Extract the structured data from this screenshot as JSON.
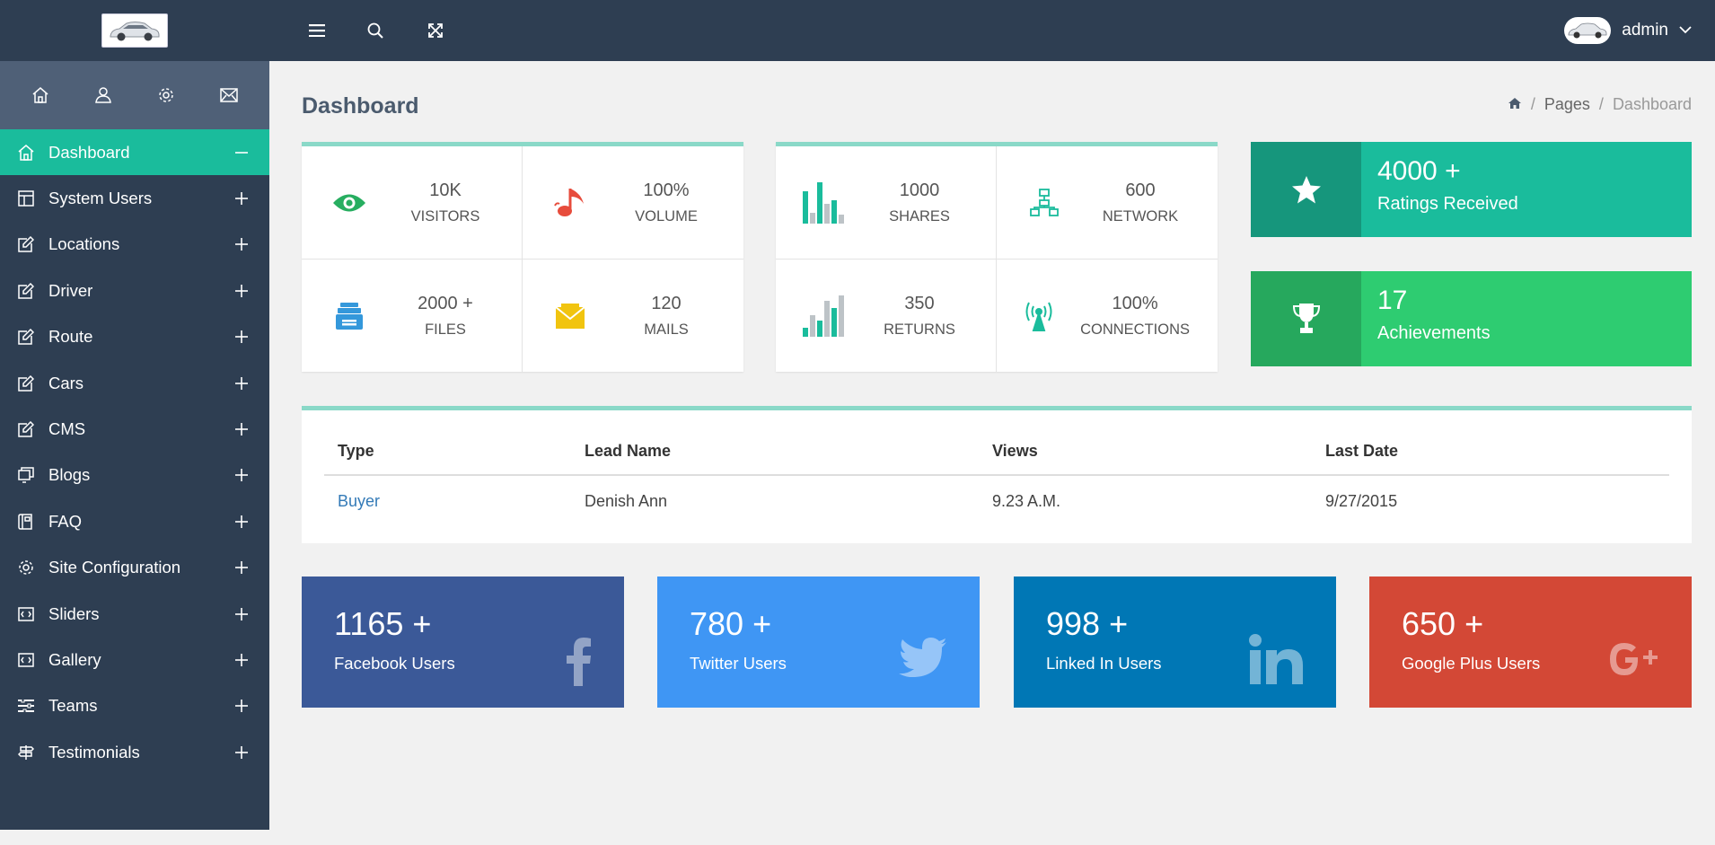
{
  "header": {
    "user_name": "admin",
    "icons": [
      "menu-icon",
      "search-icon",
      "fullscreen-icon",
      "chevron-down-icon"
    ]
  },
  "sidebar": {
    "quick_icons": [
      "home-icon",
      "user-icon",
      "gear-icon",
      "mail-icon"
    ],
    "items": [
      {
        "label": "Dashboard",
        "icon": "home-icon",
        "toggle": "−",
        "active": true
      },
      {
        "label": "System Users",
        "icon": "layout-icon",
        "toggle": "+"
      },
      {
        "label": "Locations",
        "icon": "edit-icon",
        "toggle": "+"
      },
      {
        "label": "Driver",
        "icon": "edit-icon",
        "toggle": "+"
      },
      {
        "label": "Route",
        "icon": "edit-icon",
        "toggle": "+"
      },
      {
        "label": "Cars",
        "icon": "edit-icon",
        "toggle": "+"
      },
      {
        "label": "CMS",
        "icon": "edit-icon",
        "toggle": "+"
      },
      {
        "label": "Blogs",
        "icon": "copy-icon",
        "toggle": "+"
      },
      {
        "label": "FAQ",
        "icon": "book-icon",
        "toggle": "+"
      },
      {
        "label": "Site Configuration",
        "icon": "gear-icon",
        "toggle": "+"
      },
      {
        "label": "Sliders",
        "icon": "slider-icon",
        "toggle": "+"
      },
      {
        "label": "Gallery",
        "icon": "slider-icon",
        "toggle": "+"
      },
      {
        "label": "Teams",
        "icon": "team-icon",
        "toggle": "+"
      },
      {
        "label": "Testimonials",
        "icon": "signpost-icon",
        "toggle": "+"
      }
    ]
  },
  "page": {
    "title": "Dashboard",
    "breadcrumb": [
      "Pages",
      "Dashboard"
    ]
  },
  "stats": {
    "left": [
      {
        "value": "10K",
        "label": "VISITORS",
        "icon": "eye-icon",
        "color": "#27ae60"
      },
      {
        "value": "100%",
        "label": "VOLUME",
        "icon": "music-note-icon",
        "color": "#e74c3c"
      },
      {
        "value": "2000 +",
        "label": "FILES",
        "icon": "archive-icon",
        "color": "#3498db"
      },
      {
        "value": "120",
        "label": "MAILS",
        "icon": "envelope-icon",
        "color": "#f1c40f"
      }
    ],
    "right": [
      {
        "value": "1000",
        "label": "SHARES",
        "icon": "bar-chart-icon",
        "color": "#1abc9c"
      },
      {
        "value": "600",
        "label": "NETWORK",
        "icon": "sitemap-icon",
        "color": "#1abc9c"
      },
      {
        "value": "350",
        "label": "RETURNS",
        "icon": "bar-chart-icon",
        "color": "#1abc9c"
      },
      {
        "value": "100%",
        "label": "CONNECTIONS",
        "icon": "antenna-icon",
        "color": "#1abc9c"
      }
    ]
  },
  "tiles": [
    {
      "value": "4000 +",
      "label": "Ratings Received",
      "icon": "star-icon",
      "color": "#1abc9c",
      "icon_bg": "#16967c"
    },
    {
      "value": "17",
      "label": "Achievements",
      "icon": "trophy-icon",
      "color": "#2ecc71",
      "icon_bg": "#26a85d"
    }
  ],
  "leads_table": {
    "columns": [
      "Type",
      "Lead Name",
      "Views",
      "Last Date"
    ],
    "rows": [
      {
        "type": "Buyer",
        "lead_name": "Denish Ann",
        "views": "9.23 A.M.",
        "last_date": "9/27/2015"
      }
    ]
  },
  "social": [
    {
      "count": "1165 +",
      "label": "Facebook Users",
      "icon": "facebook-icon",
      "color": "#3b5998"
    },
    {
      "count": "780 +",
      "label": "Twitter Users",
      "icon": "twitter-icon",
      "color": "#3f96f4"
    },
    {
      "count": "998 +",
      "label": "Linked In Users",
      "icon": "linkedin-icon",
      "color": "#0077b5"
    },
    {
      "count": "650 +",
      "label": "Google Plus Users",
      "icon": "google-plus-icon",
      "color": "#d34836"
    }
  ]
}
